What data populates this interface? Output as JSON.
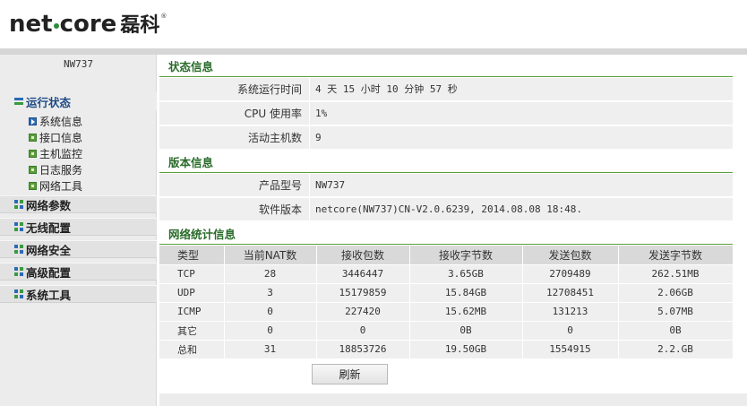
{
  "header": {
    "brand_left": "net",
    "brand_right": "core",
    "brand_cn": "磊科",
    "reg_mark": "®"
  },
  "sidebar": {
    "device_name": "NW737",
    "sections": [
      {
        "label": "运行状态",
        "active": true,
        "items": [
          "系统信息",
          "接口信息",
          "主机监控",
          "日志服务",
          "网络工具"
        ]
      },
      {
        "label": "网络参数"
      },
      {
        "label": "无线配置"
      },
      {
        "label": "网络安全"
      },
      {
        "label": "高级配置"
      },
      {
        "label": "系统工具"
      }
    ]
  },
  "status": {
    "title": "状态信息",
    "rows": [
      {
        "key": "系统运行时间",
        "value": "4 天 15 小时 10 分钟 57 秒"
      },
      {
        "key": "CPU 使用率",
        "value": "1%"
      },
      {
        "key": "活动主机数",
        "value": "9"
      }
    ]
  },
  "version": {
    "title": "版本信息",
    "rows": [
      {
        "key": "产品型号",
        "value": "NW737"
      },
      {
        "key": "软件版本",
        "value": "netcore(NW737)CN-V2.0.6239, 2014.08.08 18:48."
      }
    ]
  },
  "netstats": {
    "title": "网络统计信息",
    "headers": [
      "类型",
      "当前NAT数",
      "接收包数",
      "接收字节数",
      "发送包数",
      "发送字节数"
    ],
    "rows": [
      [
        "TCP",
        "28",
        "3446447",
        "3.65GB",
        "2709489",
        "262.51MB"
      ],
      [
        "UDP",
        "3",
        "15179859",
        "15.84GB",
        "12708451",
        "2.06GB"
      ],
      [
        "ICMP",
        "0",
        "227420",
        "15.62MB",
        "131213",
        "5.07MB"
      ],
      [
        "其它",
        "0",
        "0",
        "0B",
        "0",
        "0B"
      ],
      [
        "总和",
        "31",
        "18853726",
        "19.50GB",
        "1554915",
        "2.2.GB"
      ]
    ],
    "refresh_label": "刷新"
  }
}
